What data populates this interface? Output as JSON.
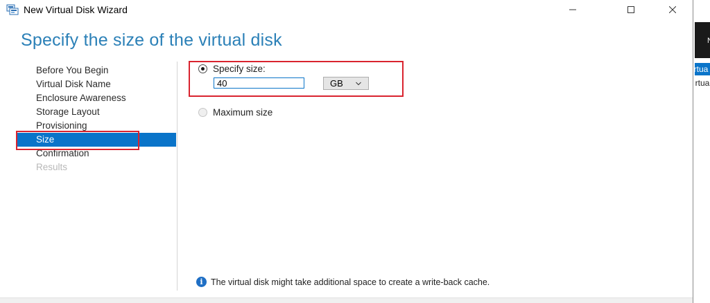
{
  "window": {
    "title": "New Virtual Disk Wizard",
    "controls": {
      "minimize": "—",
      "maximize": "☐",
      "close": "✕"
    }
  },
  "page": {
    "heading": "Specify the size of the virtual disk"
  },
  "nav": {
    "items": [
      {
        "label": "Before You Begin",
        "state": "normal"
      },
      {
        "label": "Virtual Disk Name",
        "state": "normal"
      },
      {
        "label": "Enclosure Awareness",
        "state": "normal"
      },
      {
        "label": "Storage Layout",
        "state": "normal"
      },
      {
        "label": "Provisioning",
        "state": "normal"
      },
      {
        "label": "Size",
        "state": "active"
      },
      {
        "label": "Confirmation",
        "state": "normal"
      },
      {
        "label": "Results",
        "state": "disabled"
      }
    ]
  },
  "size": {
    "specify_label": "Specify size:",
    "specify_checked": true,
    "value": "40",
    "unit": "GB",
    "maximum_label": "Maximum size",
    "maximum_checked": false
  },
  "info": {
    "icon": "info-icon",
    "text": "The virtual disk might take additional space to create a write-back cache."
  },
  "background_window": {
    "selected_row": "irtua",
    "row": "irtua"
  },
  "colors": {
    "accent": "#0a74c9",
    "heading": "#2b80b7",
    "highlight": "#d9232e"
  }
}
